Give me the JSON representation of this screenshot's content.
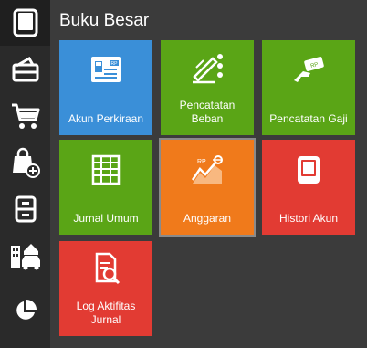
{
  "page": {
    "title": "Buku Besar"
  },
  "sidebar": {
    "items": [
      {
        "icon": "ledger-book-icon"
      },
      {
        "icon": "wallet-icon"
      },
      {
        "icon": "shopping-cart-icon"
      },
      {
        "icon": "shopping-bag-add-icon"
      },
      {
        "icon": "file-cabinet-icon"
      },
      {
        "icon": "building-car-icon"
      },
      {
        "icon": "pie-chart-icon"
      }
    ]
  },
  "tiles": [
    {
      "label": "Akun Perkiraan",
      "color": "#3a8fd8",
      "icon": "account-card-icon"
    },
    {
      "label": "Pencatatan Beban",
      "color": "#5aa516",
      "icon": "expense-record-icon"
    },
    {
      "label": "Pencatatan Gaji",
      "color": "#5aa516",
      "icon": "salary-hand-icon"
    },
    {
      "label": "Jurnal Umum",
      "color": "#5aa516",
      "icon": "journal-grid-icon"
    },
    {
      "label": "Anggaran",
      "color": "#f07a1b",
      "icon": "budget-chart-icon"
    },
    {
      "label": "Histori Akun",
      "color": "#e23b33",
      "icon": "history-book-icon"
    },
    {
      "label": "Log Aktifitas Jurnal",
      "color": "#e23b33",
      "icon": "activity-log-icon"
    }
  ],
  "currency_badge": "RP"
}
